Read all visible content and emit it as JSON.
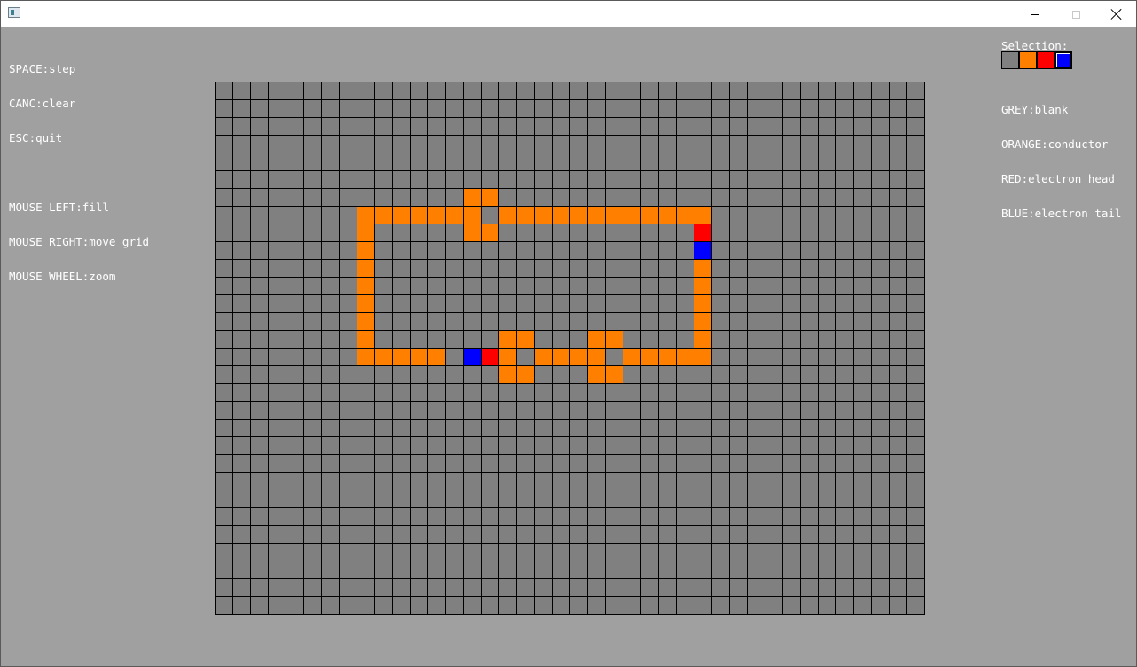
{
  "window": {
    "title": "",
    "icon": "app-window-icon",
    "controls": {
      "minimize": "minimize-icon",
      "maximize": "maximize-icon",
      "close": "close-icon"
    }
  },
  "help": {
    "lines": [
      "SPACE:step",
      "CANC:clear",
      "ESC:quit",
      "",
      "MOUSE LEFT:fill",
      "MOUSE RIGHT:move grid",
      "MOUSE WHEEL:zoom"
    ]
  },
  "selection": {
    "label": "Selection:",
    "swatches": [
      {
        "name": "grey",
        "color": "#808080",
        "selected": false
      },
      {
        "name": "orange",
        "color": "#ff8000",
        "selected": false
      },
      {
        "name": "red",
        "color": "#ff0000",
        "selected": false
      },
      {
        "name": "blue",
        "color": "#0000ff",
        "selected": true
      }
    ]
  },
  "legend": {
    "lines": [
      "GREY:blank",
      "ORANGE:conductor",
      "RED:electron head",
      "BLUE:electron tail"
    ]
  },
  "colors": {
    "background": "#a0a0a0",
    "blank": "#808080",
    "conductor": "#ff8000",
    "head": "#ff0000",
    "tail": "#0000ff",
    "gridline": "#000000"
  },
  "grid": {
    "cols": 40,
    "rows": 30,
    "conductor": [
      [
        14,
        6
      ],
      [
        15,
        6
      ],
      [
        8,
        7
      ],
      [
        9,
        7
      ],
      [
        10,
        7
      ],
      [
        11,
        7
      ],
      [
        12,
        7
      ],
      [
        13,
        7
      ],
      [
        14,
        7
      ],
      [
        16,
        7
      ],
      [
        17,
        7
      ],
      [
        18,
        7
      ],
      [
        19,
        7
      ],
      [
        20,
        7
      ],
      [
        21,
        7
      ],
      [
        22,
        7
      ],
      [
        23,
        7
      ],
      [
        24,
        7
      ],
      [
        25,
        7
      ],
      [
        26,
        7
      ],
      [
        27,
        7
      ],
      [
        14,
        8
      ],
      [
        15,
        8
      ],
      [
        8,
        8
      ],
      [
        8,
        9
      ],
      [
        8,
        10
      ],
      [
        8,
        11
      ],
      [
        8,
        12
      ],
      [
        8,
        13
      ],
      [
        8,
        14
      ],
      [
        27,
        10
      ],
      [
        27,
        11
      ],
      [
        27,
        12
      ],
      [
        27,
        13
      ],
      [
        27,
        14
      ],
      [
        16,
        14
      ],
      [
        17,
        14
      ],
      [
        21,
        14
      ],
      [
        22,
        14
      ],
      [
        8,
        15
      ],
      [
        9,
        15
      ],
      [
        10,
        15
      ],
      [
        11,
        15
      ],
      [
        12,
        15
      ],
      [
        16,
        15
      ],
      [
        18,
        15
      ],
      [
        19,
        15
      ],
      [
        20,
        15
      ],
      [
        21,
        15
      ],
      [
        23,
        15
      ],
      [
        24,
        15
      ],
      [
        25,
        15
      ],
      [
        26,
        15
      ],
      [
        27,
        15
      ],
      [
        16,
        16
      ],
      [
        17,
        16
      ],
      [
        21,
        16
      ],
      [
        22,
        16
      ]
    ],
    "head": [
      [
        27,
        8
      ],
      [
        15,
        15
      ]
    ],
    "tail": [
      [
        27,
        9
      ],
      [
        14,
        15
      ]
    ]
  }
}
